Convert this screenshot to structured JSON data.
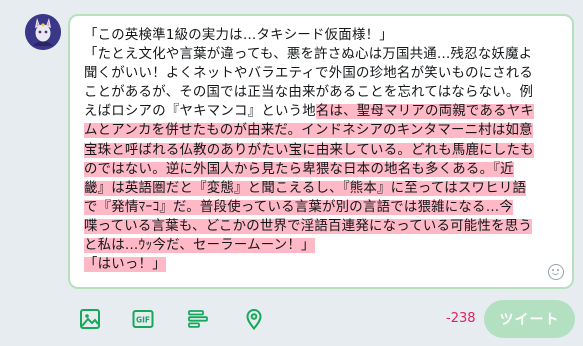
{
  "tweet": {
    "lines": [
      {
        "plain": "「この英検準1級の実力は…タキシード仮面様！」",
        "marked": ""
      },
      {
        "plain": "「たとえ文化や言葉が違っても、悪を許さぬ心は万国共通…残忍な妖魔よ",
        "marked": ""
      },
      {
        "plain": "聞くがいい！よくネットやバラエティで外国の珍地名が笑いものにされる",
        "marked": ""
      },
      {
        "plain": "ことがあるが、その国では正当な由来があることを忘れてはならない。例",
        "marked": ""
      },
      {
        "plain": "えばロシアの『ヤキマンコ』という地",
        "marked": "名は、聖母マリアの両親であるヤキ"
      },
      {
        "plain": "",
        "marked": "ムとアンカを併せたものが由来だ。インドネシアのキンタマーニ村は如意"
      },
      {
        "plain": "",
        "marked": "宝珠と呼ばれる仏教のありがたい宝に由来している。どれも馬鹿にしたも"
      },
      {
        "plain": "",
        "marked": "のではない。逆に外国人から見たら卑猥な日本の地名も多くある。『近"
      },
      {
        "plain": "",
        "marked": "畿』は英語圏だと『変態』と聞こえるし、『熊本』に至ってはスワヒリ語"
      },
      {
        "plain": "",
        "marked": "で『発情ﾏｰｺ』だ。普段使っている言葉が別の言語では猥雑になる…今"
      },
      {
        "plain": "",
        "marked": "喋っている言葉も、どこかの世界で淫語百連発になっている可能性を思う"
      },
      {
        "plain": "",
        "marked": "と私は…ｳｯ今だ、セーラームーン！」"
      },
      {
        "plain": "",
        "marked": "「はいっ！」"
      }
    ]
  },
  "toolbar": {
    "icons": [
      "image-icon",
      "gif-icon",
      "poll-icon",
      "location-icon"
    ],
    "icon_color": "#17a85c",
    "gif_label": "GIF"
  },
  "counter": "-238",
  "tweet_button_label": "ツイート",
  "colors": {
    "highlight": "#ffb8c6",
    "composer_border": "#b7e0bd",
    "button_bg": "#b3e0c1",
    "counter": "#e0245e"
  }
}
